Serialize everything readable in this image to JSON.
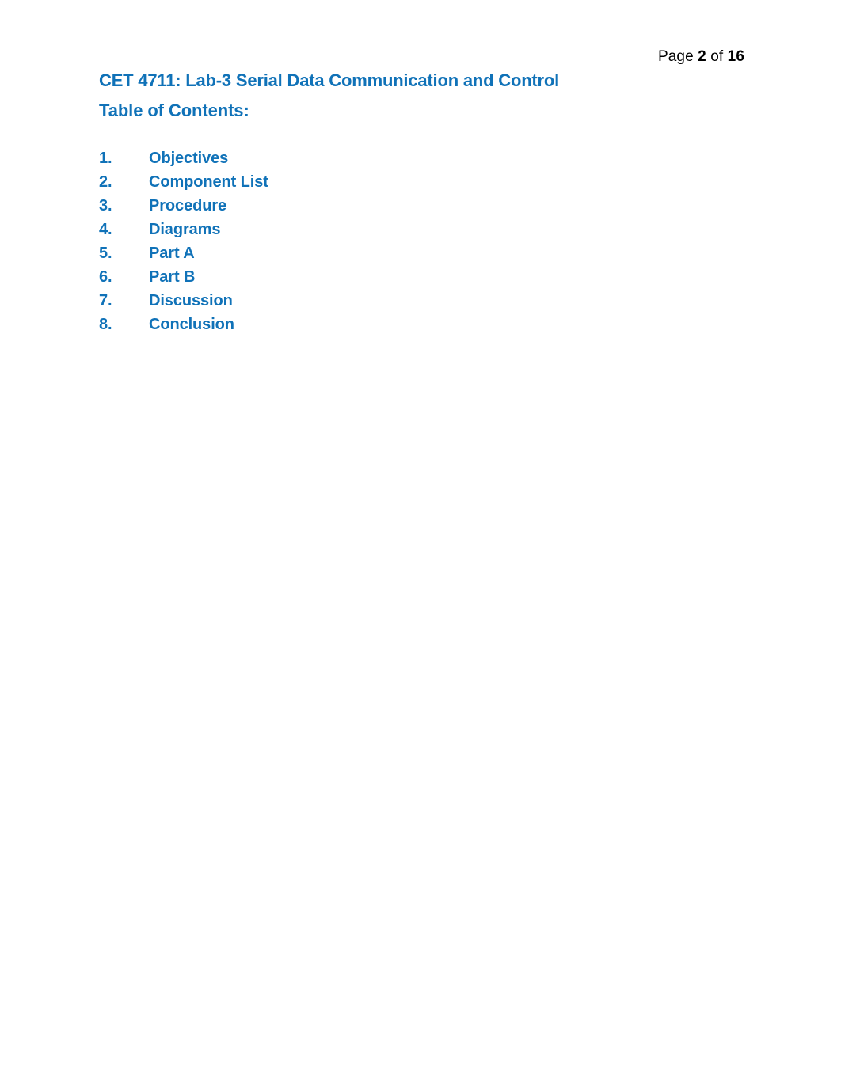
{
  "page": {
    "background_color": "#ffffff",
    "accent_color": "#1072B8",
    "text_color": "#000000"
  },
  "header": {
    "prefix": "Page",
    "current_page": "2",
    "connector": "of",
    "total_pages": "16"
  },
  "document": {
    "title": "CET 4711: Lab-3 Serial Data Communication and Control",
    "toc_heading": "Table of Contents:",
    "toc_items": [
      {
        "number": "1.",
        "label": "Objectives"
      },
      {
        "number": "2.",
        "label": "Component List"
      },
      {
        "number": "3.",
        "label": "Procedure"
      },
      {
        "number": "4.",
        "label": "Diagrams"
      },
      {
        "number": "5.",
        "label": "Part A"
      },
      {
        "number": "6.",
        "label": "Part B"
      },
      {
        "number": "7.",
        "label": "Discussion"
      },
      {
        "number": "8.",
        "label": "Conclusion"
      }
    ]
  }
}
